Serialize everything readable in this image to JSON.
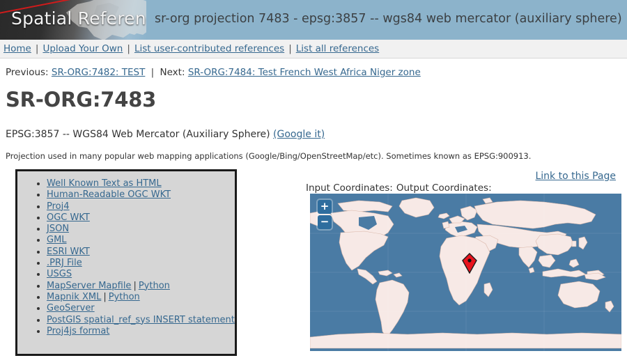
{
  "banner": {
    "logo_text": "Spatial Reference",
    "title": "sr-org projection 7483 - epsg:3857 -- wgs84 web mercator (auxiliary sphere)",
    "accent_color": "#d01b1b",
    "bg_color": "#8cb3cb"
  },
  "nav": {
    "items": [
      {
        "label": "Home"
      },
      {
        "label": "Upload Your Own"
      },
      {
        "label": "List user-contributed references"
      },
      {
        "label": "List all references"
      }
    ],
    "separator": "|"
  },
  "prevnext": {
    "previous_label": "Previous:",
    "previous_link": "SR-ORG:7482: TEST",
    "separator": "|",
    "next_label": "Next:",
    "next_link": "SR-ORG:7484: Test French West Africa Niger zone"
  },
  "page": {
    "title": "SR-ORG:7483",
    "epsg_text": "EPSG:3857 -- WGS84 Web Mercator (Auxiliary Sphere)",
    "google_it": "(Google it)",
    "description": "Projection used in many popular web mapping applications (Google/Bing/OpenStreetMap/etc). Sometimes known as EPSG:900913.",
    "link_to_page": "Link to this Page"
  },
  "formats": {
    "items": [
      {
        "label": "Well Known Text as HTML"
      },
      {
        "label": "Human-Readable OGC WKT"
      },
      {
        "label": "Proj4"
      },
      {
        "label": "OGC WKT"
      },
      {
        "label": "JSON"
      },
      {
        "label": "GML"
      },
      {
        "label": "ESRI WKT"
      },
      {
        "label": ".PRJ File"
      },
      {
        "label": "USGS"
      },
      {
        "label": "MapServer Mapfile",
        "pipe": "|",
        "label2": "Python"
      },
      {
        "label": "Mapnik XML",
        "pipe": "|",
        "label2": "Python"
      },
      {
        "label": "GeoServer"
      },
      {
        "label": "PostGIS spatial_ref_sys INSERT statement"
      },
      {
        "label": "Proj4js format"
      }
    ]
  },
  "map": {
    "input_label": "Input Coordinates:",
    "output_label": "Output Coordinates:",
    "zoom_in": "+",
    "zoom_out": "−",
    "ocean_color": "#4a7ba4",
    "land_color": "#f7e9e6",
    "border_color": "#d9b6a8",
    "marker_color": "#e8131d"
  }
}
